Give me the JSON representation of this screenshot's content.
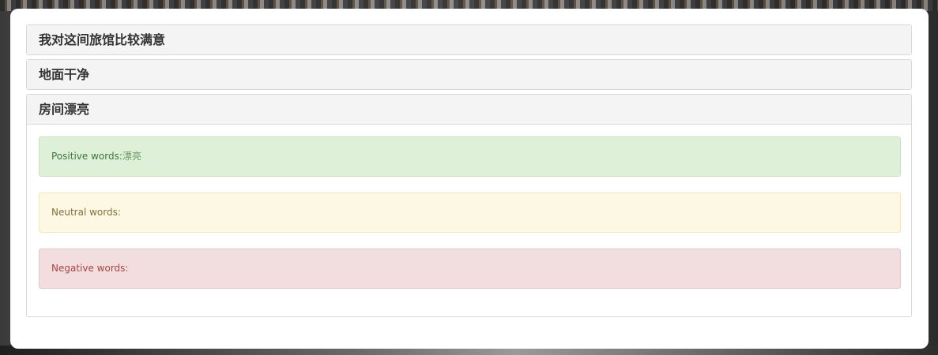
{
  "accordion": {
    "panels": [
      {
        "title": "我对这间旅馆比较满意"
      },
      {
        "title": "地面干净"
      },
      {
        "title": "房间漂亮"
      }
    ]
  },
  "sentiment": {
    "positive_label": "Positive words:",
    "positive_words": "漂亮",
    "neutral_label": "Neutral words:",
    "neutral_words": "",
    "negative_label": "Negative words:",
    "negative_words": ""
  },
  "colors": {
    "positive_bg": "#dff0d8",
    "neutral_bg": "#fcf8e3",
    "negative_bg": "#f2dede"
  }
}
